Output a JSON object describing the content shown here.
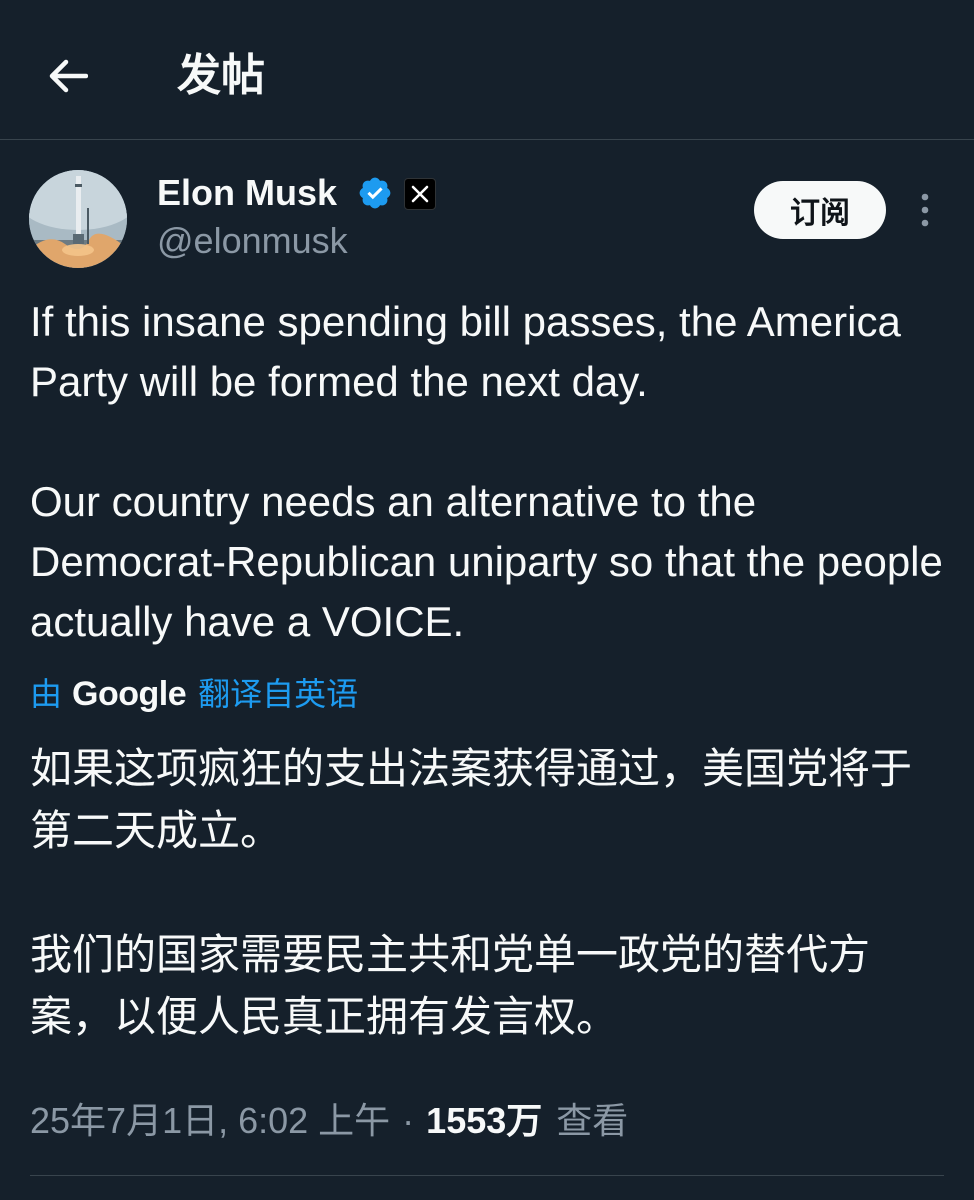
{
  "header": {
    "title": "发帖",
    "back_icon": "arrow-left-icon"
  },
  "post": {
    "author": {
      "name": "Elon Musk",
      "handle": "@elonmusk",
      "verified": true,
      "verified_color": "#1d9bf0",
      "affiliation_badge": "x-logo-icon"
    },
    "subscribe_label": "订阅",
    "more_icon": "more-vertical-icon",
    "text_paragraphs": [
      "If this insane spending bill passes, the America Party will be formed the next day.",
      "Our country needs an alternative to the Democrat-Republican uniparty so that the people actually have a VOICE."
    ],
    "translation": {
      "by_prefix": "由",
      "provider": "Google",
      "link_label": "翻译自英语",
      "link_color": "#1d9bf0"
    },
    "translated_paragraphs": [
      "如果这项疯狂的支出法案获得通过，美国党将于第二天成立。",
      "我们的国家需要民主共和党单一政党的替代方案，以便人民真正拥有发言权。"
    ],
    "meta": {
      "timestamp": "25年7月1日, 6:02 上午",
      "separator": "·",
      "views_count": "1553万",
      "views_label": "查看"
    }
  },
  "theme": {
    "background": "#15202b",
    "text": "#f7f9f9",
    "secondary_text": "#8b98a5",
    "border": "#38444d"
  }
}
